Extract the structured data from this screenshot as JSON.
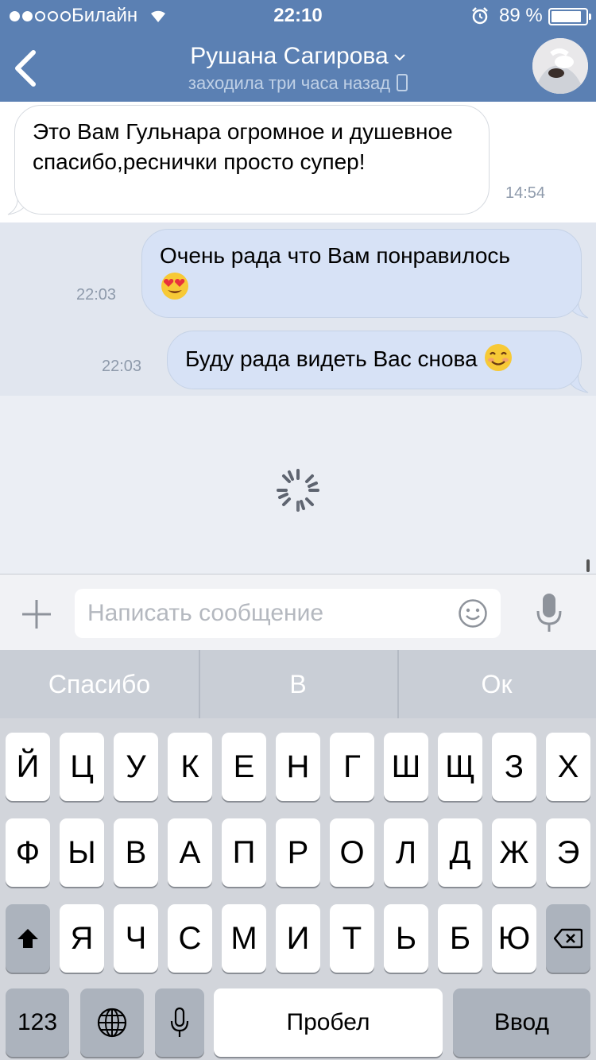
{
  "status_bar": {
    "carrier": "Билайн",
    "time": "22:10",
    "battery_pct": "89 %",
    "battery_level": 0.89,
    "signal_bars_filled": 2,
    "signal_bars_total": 5
  },
  "header": {
    "title": "Рушана Сагирова",
    "subtitle": "заходила три часа назад"
  },
  "messages": [
    {
      "direction": "incoming",
      "text": "Это Вам Гульнара огромное и душевное спасибо,реснички просто супер!",
      "time": "14:54"
    },
    {
      "direction": "outgoing",
      "text": "Очень рада что Вам понравилось",
      "emoji": "heart-eyes",
      "time": "22:03"
    },
    {
      "direction": "outgoing",
      "text": "Буду рада видеть Вас снова",
      "emoji": "smiling-face",
      "time": "22:03"
    }
  ],
  "input": {
    "placeholder": "Написать сообщение",
    "value": ""
  },
  "suggestions": [
    "Спасибо",
    "В",
    "Ок"
  ],
  "keyboard": {
    "row1": [
      "Й",
      "Ц",
      "У",
      "К",
      "Е",
      "Н",
      "Г",
      "Ш",
      "Щ",
      "З",
      "Х"
    ],
    "row2": [
      "Ф",
      "Ы",
      "В",
      "А",
      "П",
      "Р",
      "О",
      "Л",
      "Д",
      "Ж",
      "Э"
    ],
    "row3": [
      "Я",
      "Ч",
      "С",
      "М",
      "И",
      "Т",
      "Ь",
      "Б",
      "Ю"
    ],
    "numbers_label": "123",
    "space_label": "Пробел",
    "return_label": "Ввод"
  },
  "colors": {
    "header_bg": "#5b80b3",
    "outgoing_bubble": "#d7e2f6",
    "incoming_bubble": "#ffffff"
  }
}
